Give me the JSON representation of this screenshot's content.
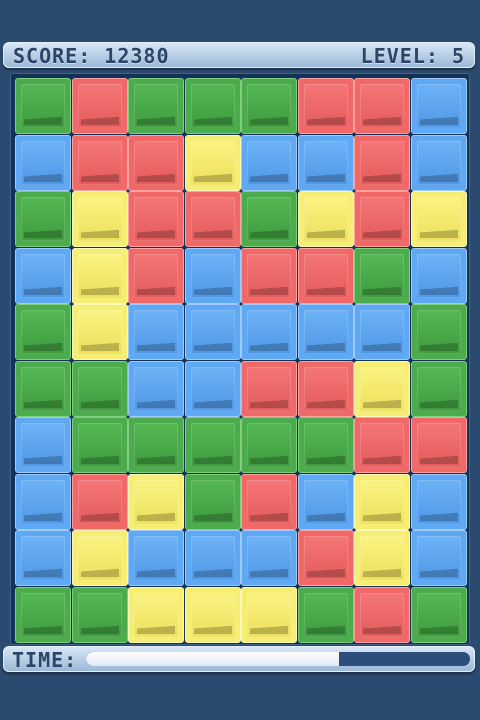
{
  "hud": {
    "score_text": "SCORE: 12380",
    "level_text": "LEVEL: 5"
  },
  "timer": {
    "label": "TIME:",
    "remaining_fraction": 0.66
  },
  "colors": {
    "green": "#4cab4c",
    "red": "#f06868",
    "blue": "#5fa8f4",
    "yellow": "#f6ee74",
    "background": "#2b4a6f"
  },
  "board": {
    "columns": 8,
    "rows": 10,
    "grid": [
      [
        "green",
        "red",
        "green",
        "green",
        "green",
        "red",
        "red",
        "blue"
      ],
      [
        "blue",
        "red",
        "red",
        "yellow",
        "blue",
        "blue",
        "red",
        "blue"
      ],
      [
        "green",
        "yellow",
        "red",
        "red",
        "green",
        "yellow",
        "red",
        "yellow"
      ],
      [
        "blue",
        "yellow",
        "red",
        "blue",
        "red",
        "red",
        "green",
        "blue"
      ],
      [
        "green",
        "yellow",
        "blue",
        "blue",
        "blue",
        "blue",
        "blue",
        "green"
      ],
      [
        "green",
        "green",
        "blue",
        "blue",
        "red",
        "red",
        "yellow",
        "green"
      ],
      [
        "blue",
        "green",
        "green",
        "green",
        "green",
        "green",
        "red",
        "red"
      ],
      [
        "blue",
        "red",
        "yellow",
        "green",
        "red",
        "blue",
        "yellow",
        "blue"
      ],
      [
        "blue",
        "yellow",
        "blue",
        "blue",
        "blue",
        "red",
        "yellow",
        "blue"
      ],
      [
        "green",
        "green",
        "yellow",
        "yellow",
        "yellow",
        "green",
        "red",
        "green"
      ]
    ]
  }
}
